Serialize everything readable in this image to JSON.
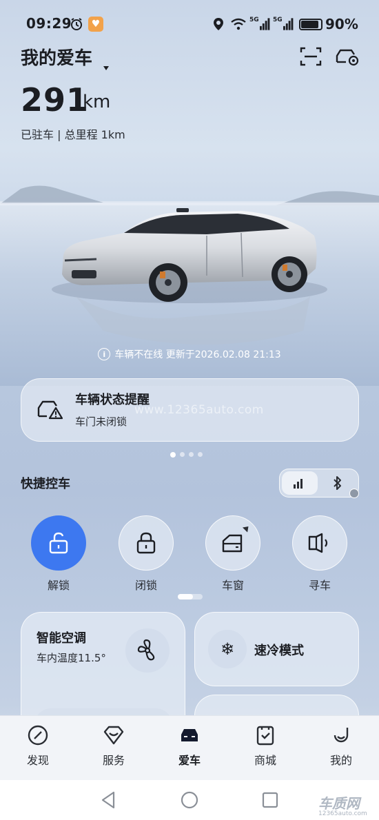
{
  "status_bar": {
    "time": "09:29",
    "signal_1": "5G",
    "signal_2": "5G",
    "battery_percent": "90%",
    "battery_level": 0.9,
    "icons": [
      "alarm-icon",
      "health-icon",
      "location-icon",
      "wifi-icon",
      "signal-icon",
      "battery-icon"
    ]
  },
  "header": {
    "title": "我的爱车",
    "range_value": "291",
    "range_unit": "km",
    "park_status": "已驻车 | 总里程 1km"
  },
  "scene": {
    "offline_notice": "车辆不在线 更新于2026.02.08 21:13"
  },
  "alert": {
    "title": "车辆状态提醒",
    "subtitle": "车门未闭锁",
    "watermark": "www.12365auto.com",
    "page_count": 4,
    "active_page": 1
  },
  "quick_control": {
    "title": "快捷控车",
    "connection_modes": [
      "signal",
      "bluetooth"
    ],
    "active_mode": "signal",
    "buttons": [
      {
        "label": "解锁",
        "icon": "unlock-icon",
        "active": true
      },
      {
        "label": "闭锁",
        "icon": "lock-icon",
        "active": false
      },
      {
        "label": "车窗",
        "icon": "window-icon",
        "active": false
      },
      {
        "label": "寻车",
        "icon": "horn-icon",
        "active": false
      }
    ]
  },
  "cards": {
    "ac_title": "智能空调",
    "ac_temp": "车内温度11.5°",
    "cool_title": "速冷模式"
  },
  "nav": {
    "items": [
      {
        "label": "发现",
        "icon": "compass-icon"
      },
      {
        "label": "服务",
        "icon": "service-icon"
      },
      {
        "label": "爱车",
        "icon": "car-icon"
      },
      {
        "label": "商城",
        "icon": "shop-icon"
      },
      {
        "label": "我的",
        "icon": "profile-icon"
      }
    ],
    "active": "爱车"
  },
  "footer": {
    "brand": "车质网",
    "brand_url": "12365auto.com"
  },
  "colors": {
    "accent": "#3d78f0",
    "text": "#1b1d22"
  }
}
